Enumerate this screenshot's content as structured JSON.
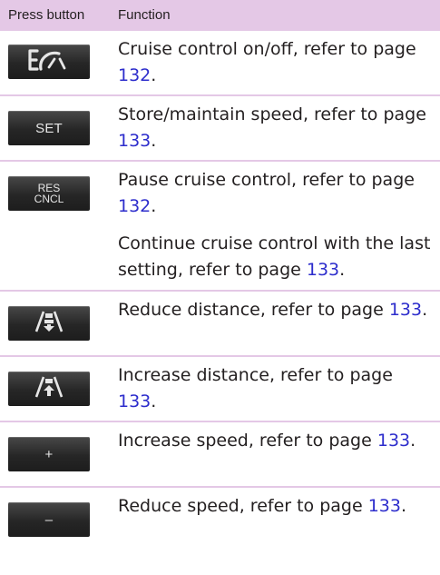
{
  "header": {
    "col_button": "Press button",
    "col_function": "Function"
  },
  "rows": [
    {
      "button": {
        "icon": "cruise-control-icon",
        "label": ""
      },
      "desc": [
        {
          "text": "Cruise control on/off, refer to page ",
          "page": "132",
          "end": "."
        }
      ]
    },
    {
      "button": {
        "icon": "",
        "label": "SET"
      },
      "desc": [
        {
          "text": "Store/maintain speed, refer to page ",
          "page": "133",
          "end": "."
        }
      ]
    },
    {
      "button": {
        "icon": "",
        "label_line1": "RES",
        "label_line2": "CNCL"
      },
      "desc": [
        {
          "text": "Pause cruise control, refer to page ",
          "page": "132",
          "end": "."
        },
        {
          "text": "Continue cruise control with the last setting, refer to page ",
          "page": "133",
          "end": "."
        }
      ]
    },
    {
      "button": {
        "icon": "distance-reduce-icon",
        "label": ""
      },
      "desc": [
        {
          "text": "Reduce distance, refer to page ",
          "page": "133",
          "end": "."
        }
      ]
    },
    {
      "button": {
        "icon": "distance-increase-icon",
        "label": ""
      },
      "desc": [
        {
          "text": "Increase distance, refer to page ",
          "page": "133",
          "end": "."
        }
      ]
    },
    {
      "button": {
        "icon": "",
        "label": "+"
      },
      "desc": [
        {
          "text": "Increase speed, refer to page ",
          "page": "133",
          "end": "."
        }
      ]
    },
    {
      "button": {
        "icon": "",
        "label": "–"
      },
      "desc": [
        {
          "text": "Reduce speed, refer to page ",
          "page": "133",
          "end": "."
        }
      ]
    }
  ]
}
